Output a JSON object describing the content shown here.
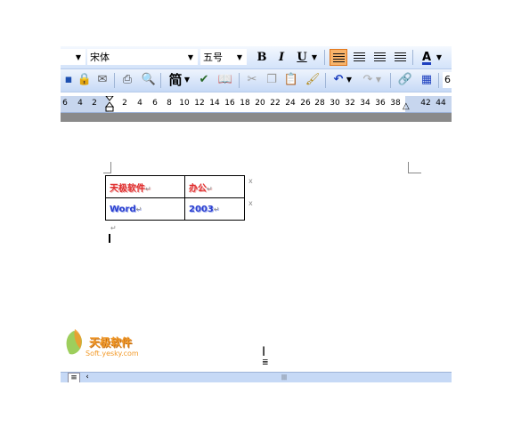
{
  "formatting_toolbar": {
    "font_name": "宋体",
    "font_size": "五号",
    "bold_label": "B",
    "italic_label": "I",
    "underline_label": "U",
    "font_color_label": "A"
  },
  "standard_toolbar": {
    "simplified_chinese_label": "简",
    "zoom_value": "6"
  },
  "ruler": {
    "ticks": [
      "6",
      "4",
      "2",
      "2",
      "4",
      "6",
      "8",
      "10",
      "12",
      "14",
      "16",
      "18",
      "20",
      "22",
      "24",
      "26",
      "28",
      "30",
      "32",
      "34",
      "36",
      "38",
      "42",
      "44"
    ]
  },
  "document": {
    "table": [
      [
        "天极软件",
        "办公"
      ],
      [
        "Word",
        "2003"
      ]
    ],
    "cell_mark": "↵"
  },
  "watermark": {
    "name": "天极软件",
    "url": "Soft.yesky.com"
  }
}
